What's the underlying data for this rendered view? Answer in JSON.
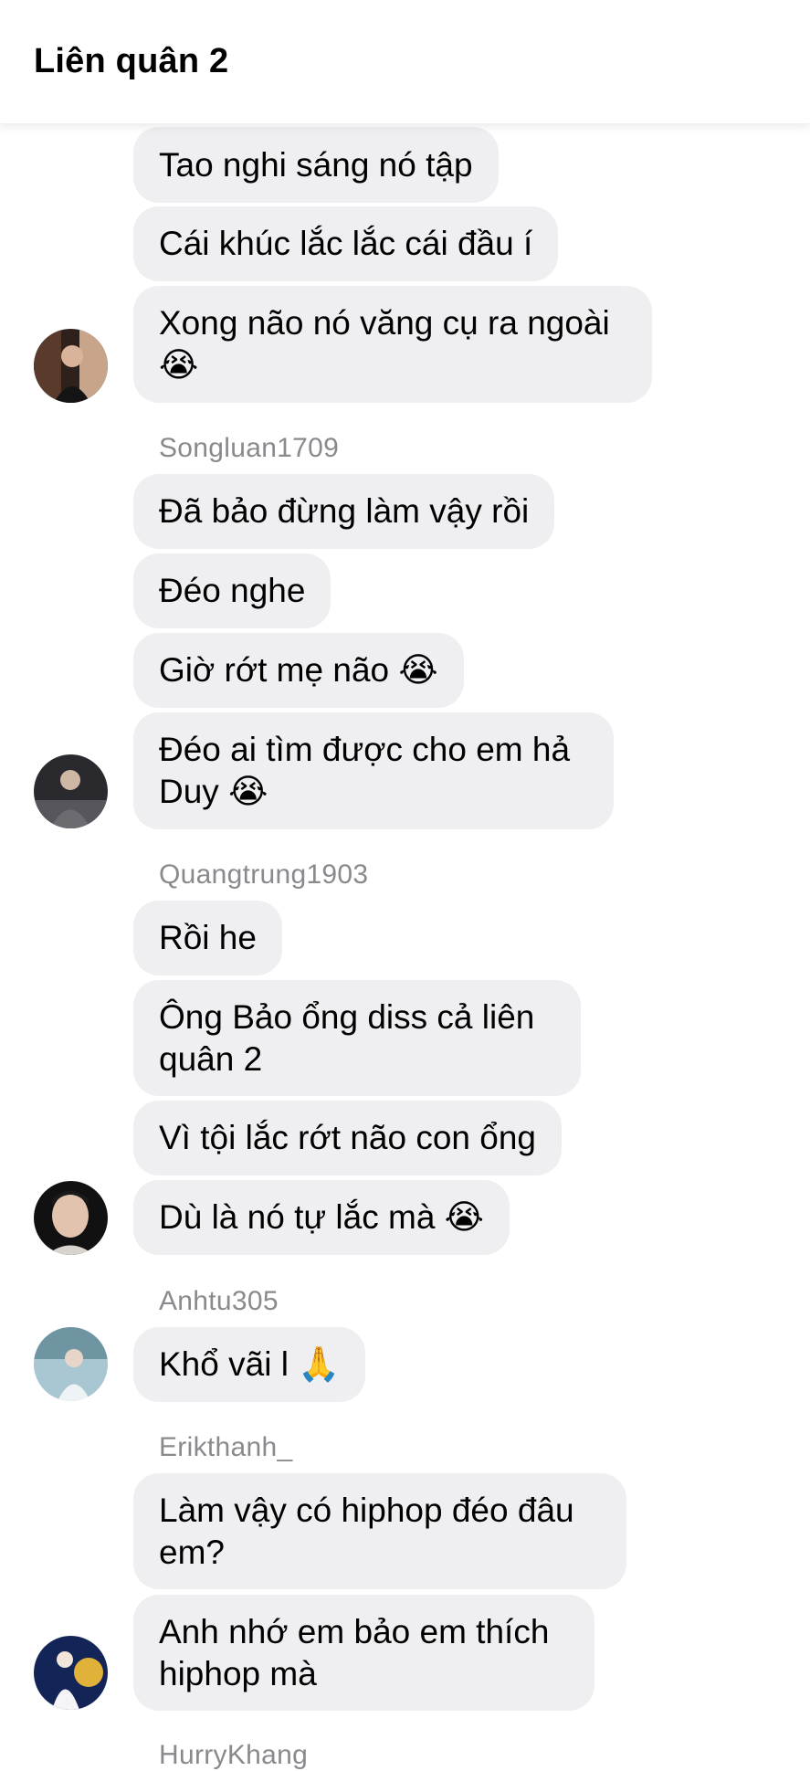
{
  "header": {
    "title": "Liên quân 2"
  },
  "messages": [
    {
      "text": "Tao nghi sáng nó tập"
    },
    {
      "text": "Cái khúc lắc lắc cái đầu í"
    },
    {
      "text": "Xong não nó văng cụ ra ngoài 😭"
    },
    {
      "text": "Đã bảo đừng làm vậy rồi"
    },
    {
      "text": "Đéo nghe"
    },
    {
      "text": "Giờ rớt mẹ não 😭"
    },
    {
      "text": "Đéo ai tìm được cho em hả Duy 😭"
    },
    {
      "text": "Rồi he"
    },
    {
      "text": "Ông Bảo ổng diss cả liên quân 2"
    },
    {
      "text": "Vì tội lắc rớt não con ổng"
    },
    {
      "text": "Dù là nó tự lắc mà 😭"
    },
    {
      "text": "Khổ vãi l 🙏"
    },
    {
      "text": "Làm vậy có hiphop đéo đâu em?"
    },
    {
      "text": "Anh nhớ em bảo em thích hiphop mà"
    }
  ],
  "senders": [
    {
      "name": "Songluan1709"
    },
    {
      "name": "Quangtrung1903"
    },
    {
      "name": "Anhtu305"
    },
    {
      "name": "Erikthanh_"
    },
    {
      "name": "HurryKhang"
    }
  ],
  "avatars": [
    {
      "icon": "avatar-photo-1",
      "color": "#3a2a22"
    },
    {
      "icon": "avatar-photo-2",
      "color": "#4a4a4e"
    },
    {
      "icon": "avatar-photo-3",
      "color": "#1c1c1c"
    },
    {
      "icon": "avatar-photo-4",
      "color": "#8fb3c0"
    },
    {
      "icon": "avatar-photo-5",
      "color": "#1d2f6b"
    }
  ],
  "colors": {
    "bubble": "#efeff2",
    "sender_text": "#8a8a8e",
    "background": "#ffffff"
  }
}
